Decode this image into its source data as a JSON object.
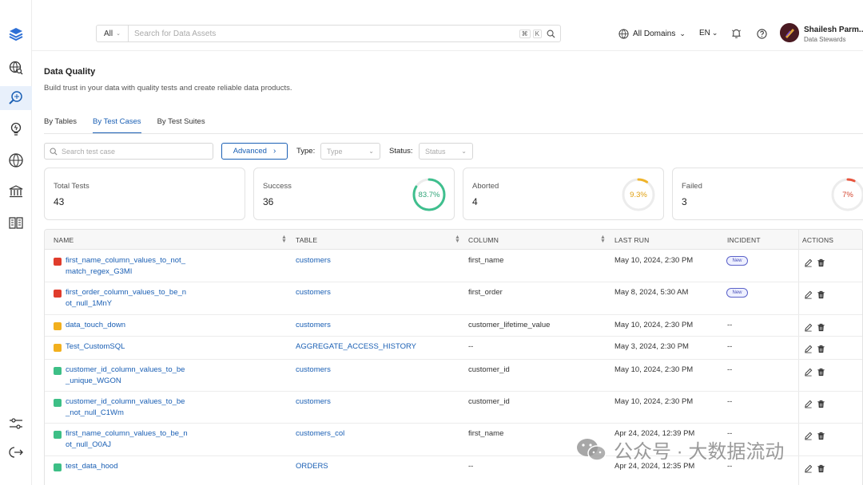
{
  "search": {
    "scope": "All",
    "placeholder": "Search for Data Assets",
    "kbd1": "⌘",
    "kbd2": "K"
  },
  "topbar": {
    "domain": "All Domains",
    "lang": "EN"
  },
  "user": {
    "name": "Shailesh Parm...",
    "role": "Data Stewards"
  },
  "page": {
    "title": "Data Quality",
    "subtitle": "Build trust in your data with quality tests and create reliable data products."
  },
  "tabs": [
    {
      "label": "By Tables"
    },
    {
      "label": "By Test Cases"
    },
    {
      "label": "By Test Suites"
    }
  ],
  "filters": {
    "search_placeholder": "Search test case",
    "advanced": "Advanced",
    "type_label": "Type:",
    "type_placeholder": "Type",
    "status_label": "Status:",
    "status_placeholder": "Status"
  },
  "cards": [
    {
      "label": "Total Tests",
      "value": "43"
    },
    {
      "label": "Success",
      "value": "36",
      "percent": "83.7%",
      "fraction": 0.837,
      "color": "#3fbf8e"
    },
    {
      "label": "Aborted",
      "value": "4",
      "percent": "9.3%",
      "fraction": 0.093,
      "color": "#f0b429"
    },
    {
      "label": "Failed",
      "value": "3",
      "percent": "7%",
      "fraction": 0.07,
      "color": "#e8553e"
    }
  ],
  "columns": [
    "NAME",
    "TABLE",
    "COLUMN",
    "LAST RUN",
    "INCIDENT",
    "ACTIONS"
  ],
  "rows": [
    {
      "status": "#e03c2c",
      "name1": "first_name_column_values_to_not_",
      "name2": "match_regex_G3MI",
      "table": "customers",
      "column": "first_name",
      "last_run": "May 10, 2024, 2:30 PM",
      "incident": "New"
    },
    {
      "status": "#e03c2c",
      "name1": "first_order_column_values_to_be_n",
      "name2": "ot_null_1MnY",
      "table": "customers",
      "column": "first_order",
      "last_run": "May 8, 2024, 5:30 AM",
      "incident": "New"
    },
    {
      "status": "#f2b01e",
      "name1": "data_touch_down",
      "name2": "",
      "table": "customers",
      "column": "customer_lifetime_value",
      "last_run": "May 10, 2024, 2:30 PM",
      "incident": "--"
    },
    {
      "status": "#f2b01e",
      "name1": "Test_CustomSQL",
      "name2": "",
      "table": "AGGREGATE_ACCESS_HISTORY",
      "column": "--",
      "last_run": "May 3, 2024, 2:30 PM",
      "incident": "--"
    },
    {
      "status": "#3dbf86",
      "name1": "customer_id_column_values_to_be",
      "name2": "_unique_WGON",
      "table": "customers",
      "column": "customer_id",
      "last_run": "May 10, 2024, 2:30 PM",
      "incident": "--"
    },
    {
      "status": "#3dbf86",
      "name1": "customer_id_column_values_to_be",
      "name2": "_not_null_C1Wm",
      "table": "customers",
      "column": "customer_id",
      "last_run": "May 10, 2024, 2:30 PM",
      "incident": "--"
    },
    {
      "status": "#3dbf86",
      "name1": "first_name_column_values_to_be_n",
      "name2": "ot_null_O0AJ",
      "table": "customers_col",
      "column": "first_name",
      "last_run": "Apr 24, 2024, 12:39 PM",
      "incident": "--"
    },
    {
      "status": "#3dbf86",
      "name1": "test_data_hood",
      "name2": "",
      "table": "ORDERS",
      "column": "--",
      "last_run": "Apr 24, 2024, 12:35 PM",
      "incident": "--"
    }
  ],
  "watermark": "公众号 · 大数据流动"
}
